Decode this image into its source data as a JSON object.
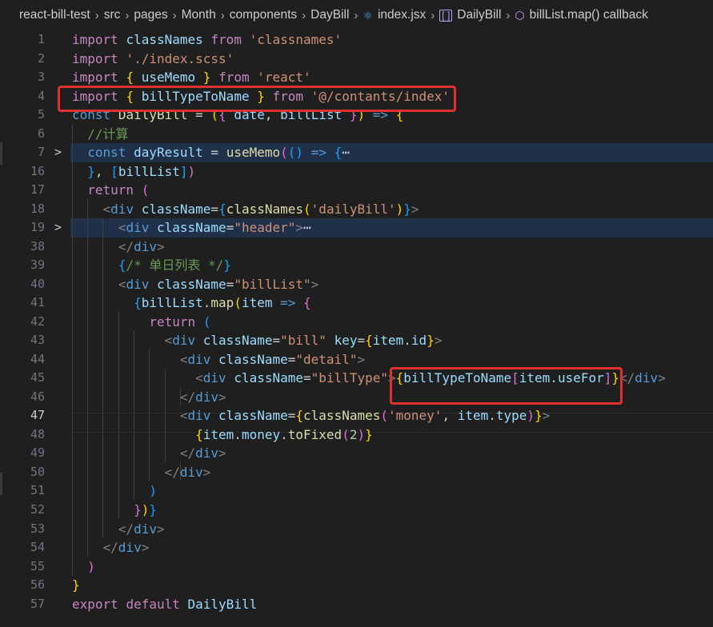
{
  "breadcrumb": {
    "items": [
      {
        "label": "react-bill-test",
        "icon": ""
      },
      {
        "label": "src",
        "icon": ""
      },
      {
        "label": "pages",
        "icon": ""
      },
      {
        "label": "Month",
        "icon": ""
      },
      {
        "label": "components",
        "icon": ""
      },
      {
        "label": "DayBill",
        "icon": ""
      },
      {
        "label": "index.jsx",
        "icon": "react-icon"
      },
      {
        "label": "DailyBill",
        "icon": "bracket-icon"
      },
      {
        "label": "billList.map() callback",
        "icon": "box-icon"
      }
    ]
  },
  "editor": {
    "active_line": "47",
    "lines": [
      {
        "num": "1"
      },
      {
        "num": "2"
      },
      {
        "num": "3"
      },
      {
        "num": "4"
      },
      {
        "num": "5"
      },
      {
        "num": "6"
      },
      {
        "num": "7"
      },
      {
        "num": "16"
      },
      {
        "num": "17"
      },
      {
        "num": "18"
      },
      {
        "num": "19"
      },
      {
        "num": "38"
      },
      {
        "num": "39"
      },
      {
        "num": "40"
      },
      {
        "num": "41"
      },
      {
        "num": "42"
      },
      {
        "num": "43"
      },
      {
        "num": "44"
      },
      {
        "num": "45"
      },
      {
        "num": "46"
      },
      {
        "num": "47"
      },
      {
        "num": "48"
      },
      {
        "num": "49"
      },
      {
        "num": "50"
      },
      {
        "num": "51"
      },
      {
        "num": "52"
      },
      {
        "num": "53"
      },
      {
        "num": "54"
      },
      {
        "num": "55"
      },
      {
        "num": "56"
      },
      {
        "num": "57"
      }
    ],
    "folded": [
      "7",
      "19"
    ],
    "fold_icon": "chevron-right-icon",
    "ellipsis": "⋯",
    "tokens": {
      "import": "import",
      "from": "from",
      "const": "const",
      "return": "return",
      "export": "export",
      "default": "default",
      "classNames": "classNames",
      "useMemo": "useMemo",
      "billTypeToName": "billTypeToName",
      "DailyBill": "DailyBill",
      "dayResult": "dayResult",
      "date": "date",
      "billList": "billList",
      "item": "item",
      "div": "div",
      "className": "className",
      "key": "key",
      "map": "map",
      "id": "id",
      "useFor": "useFor",
      "money": "money",
      "type": "type",
      "toFixed": "toFixed",
      "str_classnames": "'classnames'",
      "str_scss": "'./index.scss'",
      "str_react": "'react'",
      "str_contants": "'@/contants/index'",
      "str_dailyBill": "'dailyBill'",
      "str_header": "\"header\"",
      "str_billList": "\"billList\"",
      "str_bill": "\"bill\"",
      "str_detail": "\"detail\"",
      "str_billType": "\"billType\"",
      "str_money": "'money'",
      "num_2": "2",
      "comment_calc": "//计算",
      "comment_list": "/* 单日列表 */"
    }
  },
  "colors": {
    "highlight": "#e0312f",
    "background": "#1f1f1f"
  }
}
